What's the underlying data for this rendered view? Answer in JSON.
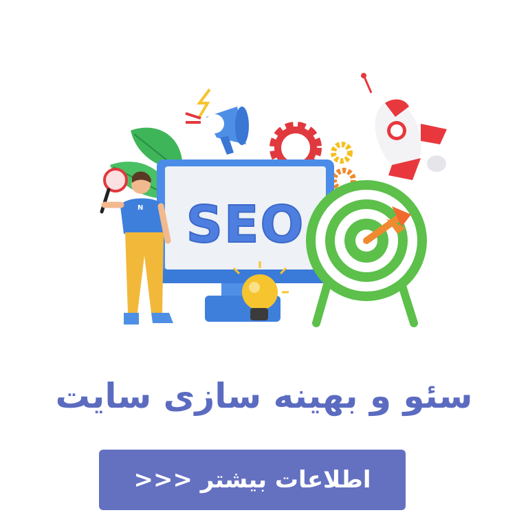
{
  "illustration": {
    "monitor_text": "SEO",
    "shirt_letter": "N",
    "icons": [
      "megaphone-icon",
      "rocket-icon",
      "gear-icon",
      "target-icon",
      "dart-icon",
      "lightbulb-icon",
      "magnifier-icon",
      "leaf-icon",
      "person-figure"
    ]
  },
  "headline": "سئو و بهینه سازی سایت",
  "cta": {
    "label": "اطلاعات بیشتر <<<"
  },
  "colors": {
    "headline": "#5b6bc0",
    "button": "#6470c0",
    "seo_text": "#4e7fe0",
    "target_green": "#5cc04a",
    "rocket_red": "#e8383d"
  }
}
